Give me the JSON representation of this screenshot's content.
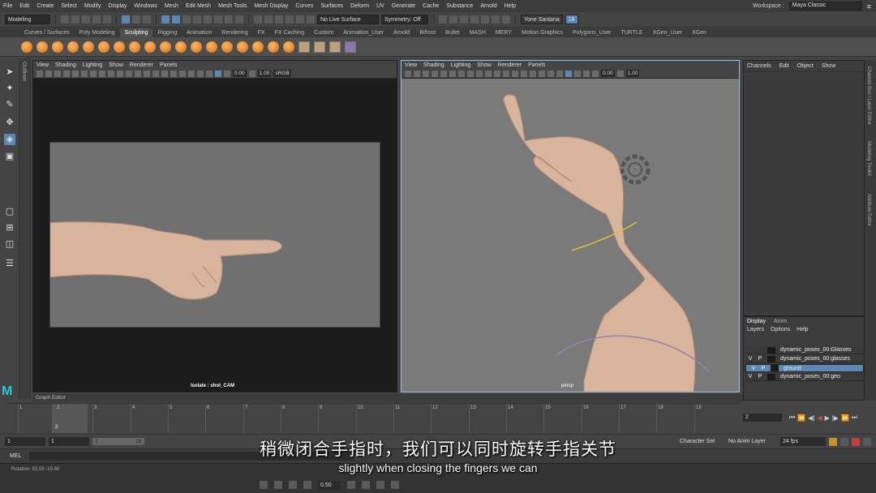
{
  "menubar": {
    "items": [
      "File",
      "Edit",
      "Create",
      "Select",
      "Modify",
      "Display",
      "Windows",
      "Mesh",
      "Edit Mesh",
      "Mesh Tools",
      "Mesh Display",
      "Curves",
      "Surfaces",
      "Deform",
      "UV",
      "Generate",
      "Cache",
      "Substance",
      "Arnold",
      "Help"
    ],
    "workspace_label": "Workspace :",
    "workspace_value": "Maya Classic"
  },
  "statusline": {
    "mode": "Modeling",
    "live_surface": "No Live Surface",
    "symmetry": "Symmetry: Off",
    "user": "Yone Santana",
    "badge": "18"
  },
  "shelf": {
    "tabs": [
      "Curves / Surfaces",
      "Poly Modeling",
      "Sculpting",
      "Rigging",
      "Animation",
      "Rendering",
      "FX",
      "FX Caching",
      "Custom",
      "Animation_User",
      "Arnold",
      "Bifrost",
      "Bullet",
      "MASH",
      "MERY",
      "Motion Graphics",
      "Polygons_User",
      "TURTLE",
      "XGen_User",
      "XGen"
    ],
    "active": "Sculpting"
  },
  "outliner": {
    "label": "Outliner"
  },
  "left_panel": {
    "menu": [
      "View",
      "Shading",
      "Lighting",
      "Show",
      "Renderer",
      "Panels"
    ],
    "f1": "0.00",
    "f2": "1.00",
    "color": "sRGB",
    "hud": "Isolate : shot_CAM"
  },
  "right_panel": {
    "menu": [
      "View",
      "Shading",
      "Lighting",
      "Show",
      "Renderer",
      "Panels"
    ],
    "f1": "0.00",
    "f2": "1.00",
    "hud": "persp"
  },
  "channelbox": {
    "menu": [
      "Channels",
      "Edit",
      "Object",
      "Show"
    ]
  },
  "vertical_tabs": [
    "Channel Box / Layer Editor",
    "Modeling Toolkit",
    "Attribute Editor"
  ],
  "layers": {
    "tabs": [
      "Display",
      "Anim"
    ],
    "menu": [
      "Layers",
      "Options",
      "Help"
    ],
    "rows": [
      {
        "v": "",
        "p": "",
        "name": "dynamic_poses_00:Glasses"
      },
      {
        "v": "V",
        "p": "P",
        "name": "dynamic_poses_00:glasses"
      },
      {
        "v": "V",
        "p": "P",
        "name": "ground"
      },
      {
        "v": "V",
        "p": "P",
        "name": "dynamic_poses_00:geo"
      }
    ]
  },
  "graph_editor": {
    "label": "Graph Editor"
  },
  "timeline": {
    "ticks": [
      "1",
      "2",
      "3",
      "4",
      "5",
      "6",
      "7",
      "8",
      "9",
      "10",
      "11",
      "12",
      "13",
      "14",
      "15",
      "16",
      "17",
      "18",
      "19"
    ],
    "current": "2",
    "current_field": "2"
  },
  "range": {
    "start": "1",
    "start2": "1",
    "inner_start": "1",
    "inner_end": "19",
    "character_set": "Character Set",
    "anim_layer": "No Anim Layer",
    "fps": "24 fps"
  },
  "mel": {
    "label": "MEL"
  },
  "status": {
    "rotation": "Rotation:   82.00   -15.60",
    "value": "0.50"
  },
  "subtitles": {
    "zh": "稍微闭合手指时，我们可以同时旋转手指关节",
    "en": "slightly when closing the fingers we can"
  }
}
